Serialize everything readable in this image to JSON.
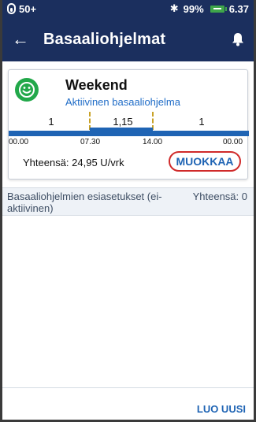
{
  "status_bar": {
    "pod_count": "50+",
    "battery_percent": "99%",
    "time": "6.37",
    "icons": [
      "pod-icon",
      "bluetooth-icon",
      "battery-icon"
    ]
  },
  "app_bar": {
    "title": "Basaaliohjelmat",
    "icons": [
      "back-arrow-icon",
      "bell-icon"
    ]
  },
  "active_program": {
    "name": "Weekend",
    "subtitle": "Aktiivinen basaaliohjelma",
    "segments": [
      {
        "rate": "1",
        "start": "00.00",
        "end": "07.30"
      },
      {
        "rate": "1,15",
        "start": "07.30",
        "end": "14.00"
      },
      {
        "rate": "1",
        "start": "14.00",
        "end": "00.00"
      }
    ],
    "ticks": [
      "00.00",
      "07.30",
      "14.00",
      "00.00"
    ],
    "total": "Yhteensä: 24,95 U/vrk",
    "edit_label": "MUOKKAA",
    "colors": {
      "bar": "#1f64b4",
      "accent": "#22a84a",
      "highlight": "#d02a2a"
    }
  },
  "presets": {
    "label": "Basaaliohjelmien esiasetukset (ei-aktiivinen)",
    "total": "Yhteensä: 0"
  },
  "footer": {
    "new_label": "LUO UUSI"
  }
}
